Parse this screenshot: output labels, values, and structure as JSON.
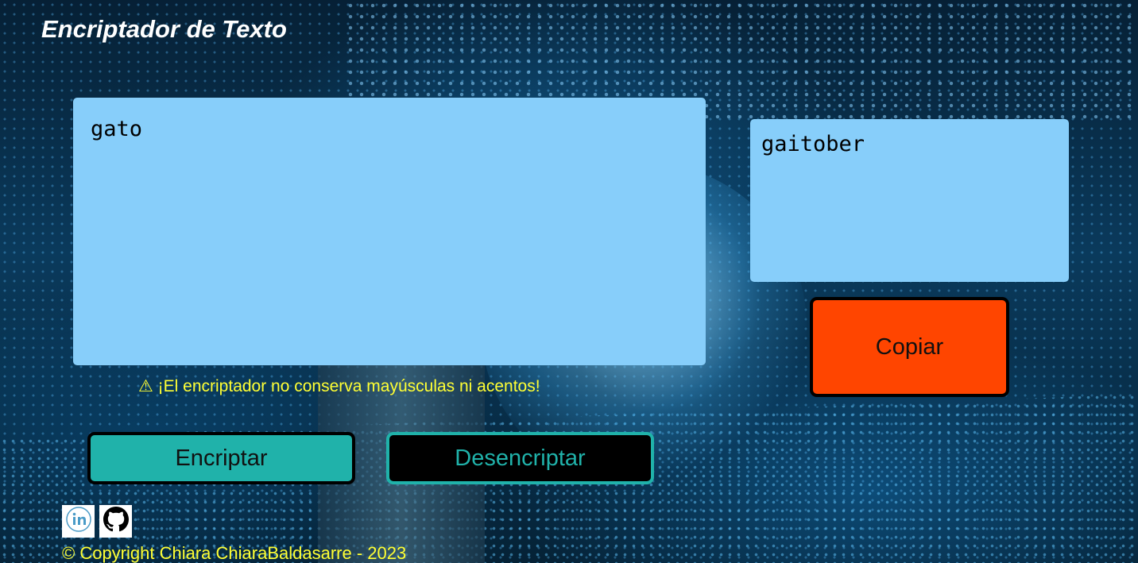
{
  "header": {
    "title": "Encriptador de Texto"
  },
  "input": {
    "value": "gato"
  },
  "output": {
    "value": "gaitober"
  },
  "buttons": {
    "copy_label": "Copiar",
    "encrypt_label": "Encriptar",
    "decrypt_label": "Desencriptar"
  },
  "warning": {
    "icon": "warning-icon",
    "text": "⚠ ¡El encriptador no conserva mayúsculas ni acentos!"
  },
  "footer": {
    "social": [
      {
        "name": "linkedin-icon"
      },
      {
        "name": "github-icon"
      }
    ],
    "copyright": "© Copyright Chiara ChiaraBaldasarre - 2023"
  },
  "colors": {
    "textarea_bg": "#87cefa",
    "copy_bg": "#ff4500",
    "encrypt_bg": "#20b2aa",
    "decrypt_bg": "#000000",
    "decrypt_text": "#20b2aa",
    "warning_text": "#ffff33",
    "title_text": "#ffffff"
  }
}
